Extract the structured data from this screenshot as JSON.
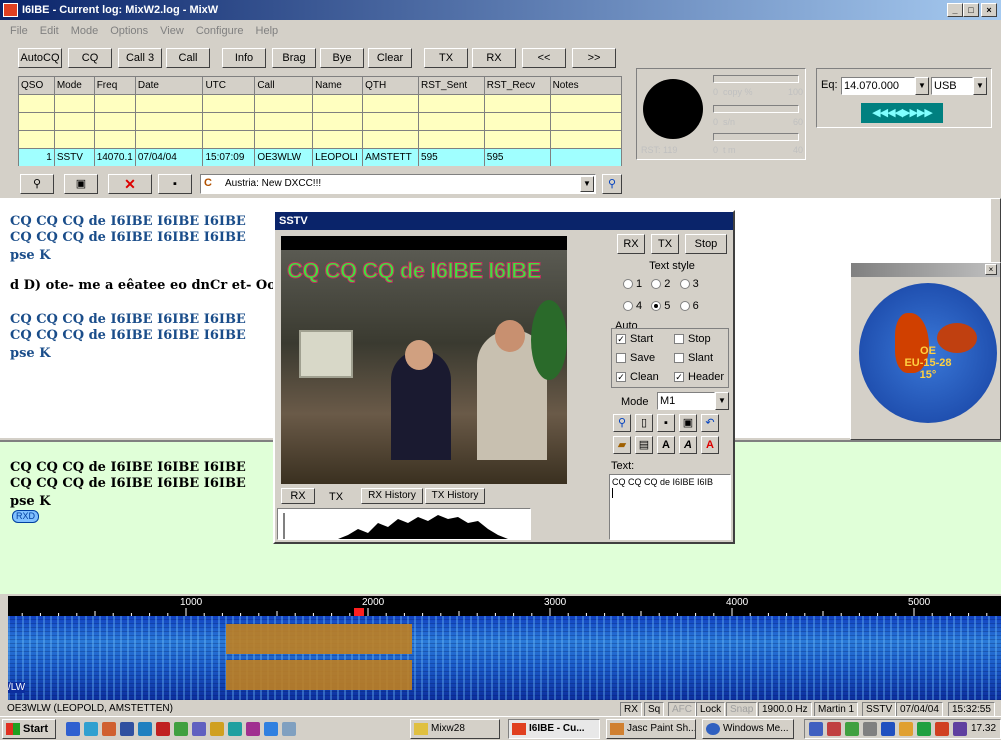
{
  "window": {
    "title": "I6IBE - Current log: MixW2.log - MixW",
    "min": "_",
    "max": "□",
    "close": "×"
  },
  "menu": [
    "File",
    "Edit",
    "Mode",
    "Options",
    "View",
    "Configure",
    "Help"
  ],
  "toolbar": {
    "buttons": [
      "AutoCQ",
      "CQ",
      "Call 3",
      "Call",
      "Info",
      "Brag",
      "Bye",
      "Clear",
      "TX",
      "RX",
      "<<",
      ">>"
    ]
  },
  "log": {
    "headers": [
      "QSO",
      "Mode",
      "Freq",
      "Date",
      "UTC",
      "Call",
      "Name",
      "QTH",
      "RST_Sent",
      "RST_Recv",
      "Notes"
    ],
    "row": {
      "qso": "1",
      "mode": "SSTV",
      "freq": "14070.1",
      "date": "07/04/04",
      "utc": "15:07:09",
      "call": "OE3WLW",
      "name": "LEOPOLI",
      "qth": "AMSTETT",
      "rst_sent": "595",
      "rst_recv": "595",
      "notes": ""
    }
  },
  "logbar": {
    "dxcc": "Austria: New DXCC!!!"
  },
  "meters": {
    "rst": "RST: 119",
    "copy_label": "copy %",
    "copy_max": "100",
    "sn_label": "s/n",
    "sn_max": "60",
    "tm_label": "t m",
    "tm_max": "40",
    "zero": "0"
  },
  "rig": {
    "label": "Eq:",
    "freq": "14.070.000",
    "mode": "USB",
    "arrows": "◀◀◀◀▶▶▶▶"
  },
  "rx_lines": [
    "CQ CQ CQ de I6IBE I6IBE I6IBE",
    "CQ CQ CQ de I6IBE I6IBE I6IBE",
    "pse K",
    "d D) ote- me  a   eêatee eo dnCr et- Oo:i",
    "CQ CQ CQ de I6IBE I6IBE I6IBE",
    "CQ CQ CQ de I6IBE I6IBE I6IBE",
    "pse K"
  ],
  "tx_lines": [
    "CQ CQ CQ de I6IBE I6IBE I6IBE",
    "CQ CQ CQ de I6IBE I6IBE I6IBE",
    "pse K"
  ],
  "tx_tag": "RXD",
  "sstv": {
    "title": "SSTV",
    "image_text": "CQ CQ CQ de I6IBE I6IBE",
    "buttons": [
      "RX",
      "TX",
      "Stop"
    ],
    "text_style_label": "Text style",
    "styles": [
      "1",
      "2",
      "3",
      "4",
      "5",
      "6"
    ],
    "selected_style": "5",
    "auto_label": "Auto",
    "auto": [
      {
        "label": "Start",
        "checked": true
      },
      {
        "label": "Stop",
        "checked": false
      },
      {
        "label": "Save",
        "checked": false
      },
      {
        "label": "Slant",
        "checked": false
      },
      {
        "label": "Clean",
        "checked": true
      },
      {
        "label": "Header",
        "checked": true
      }
    ],
    "mode_label": "Mode",
    "mode_value": "M1",
    "text_label": "Text:",
    "text_value": "CQ CQ CQ de I6IBE I6IB",
    "tabs": [
      "RX",
      "TX",
      "RX History",
      "TX History"
    ],
    "active_tab": "TX"
  },
  "map": {
    "prefix": "OE",
    "zone": "EU-15-28",
    "bearing": "15°",
    "close": "×"
  },
  "waterfall": {
    "scale": [
      "1000",
      "2000",
      "3000",
      "4000",
      "5000"
    ],
    "marker": 2000,
    "callsign_fragment": "/LW"
  },
  "status": {
    "text": "OE3WLW (LEOPOLD, AMSTETTEN)",
    "cells": [
      "RX",
      "Sq",
      "AFC",
      "Lock",
      "Snap",
      "1900.0 Hz",
      "Martin 1",
      "SSTV",
      "07/04/04",
      "15:32:55"
    ]
  },
  "taskbar": {
    "start": "Start",
    "tasks": [
      "Mixw28",
      "I6IBE - Cu...",
      "Jasc Paint Sh...",
      "Windows Me..."
    ],
    "clock": "17.32"
  },
  "colors": {
    "title": "#0a246a",
    "rxtext": "#1a4d8a",
    "txbg": "#e0ffd8",
    "log": "#ffffc0",
    "logsel": "#a0ffff"
  }
}
